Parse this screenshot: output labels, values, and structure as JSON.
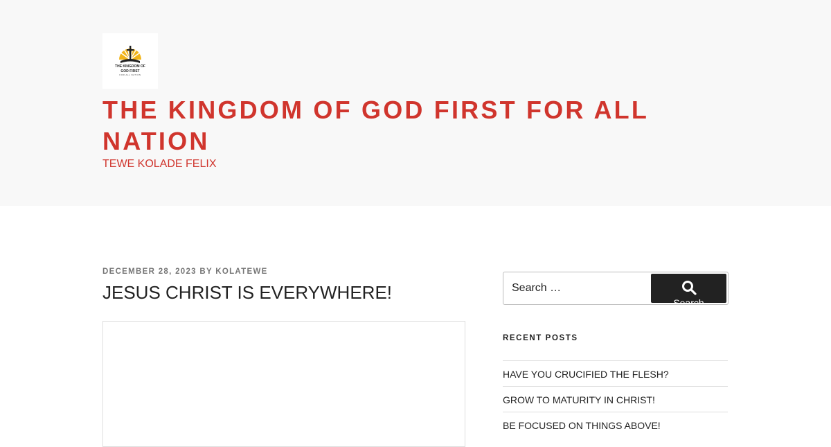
{
  "site": {
    "title": "THE KINGDOM OF GOD FIRST FOR ALL NATION",
    "tagline": "TEWE KOLADE FELIX",
    "logo_text_line1": "THE KINGDOM OF",
    "logo_text_line2": "GOD FIRST",
    "logo_text_line3": "FOR ALL NATION"
  },
  "post": {
    "date": "DECEMBER 28, 2023",
    "by": "BY",
    "author": "KOLATEWE",
    "title": "JESUS CHRIST IS EVERYWHERE!"
  },
  "sidebar": {
    "search": {
      "placeholder": "Search …",
      "button_label": "Search"
    },
    "recent_posts": {
      "title": "RECENT POSTS",
      "items": [
        {
          "label": "HAVE YOU CRUCIFIED THE FLESH?"
        },
        {
          "label": "GROW TO MATURITY IN CHRIST!"
        },
        {
          "label": "BE FOCUSED ON THINGS ABOVE!"
        }
      ]
    }
  },
  "colors": {
    "accent": "#d0352d",
    "header_bg": "#f8f8f8",
    "button_bg": "#222222"
  }
}
